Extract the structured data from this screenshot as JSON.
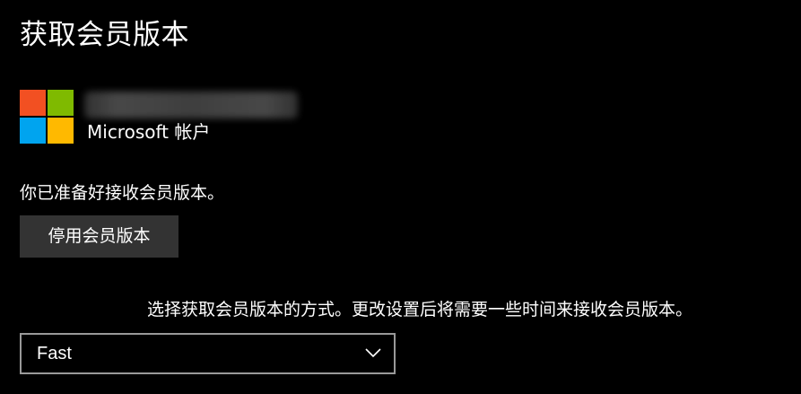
{
  "page": {
    "title": "获取会员版本"
  },
  "account": {
    "label": "Microsoft 帐户",
    "logo_icon": "microsoft-logo-icon",
    "logo_colors": [
      "#f25022",
      "#7fba00",
      "#00a4ef",
      "#ffb900"
    ]
  },
  "status": {
    "ready_text": "你已准备好接收会员版本。"
  },
  "actions": {
    "stop_label": "停用会员版本"
  },
  "method": {
    "description": "选择获取会员版本的方式。更改设置后将需要一些时间来接收会员版本。",
    "selected": "Fast",
    "chevron_icon": "chevron-down-icon"
  },
  "colors": {
    "background": "#000000",
    "text": "#ffffff",
    "button": "#333333",
    "dropdown_border": "#999999"
  }
}
